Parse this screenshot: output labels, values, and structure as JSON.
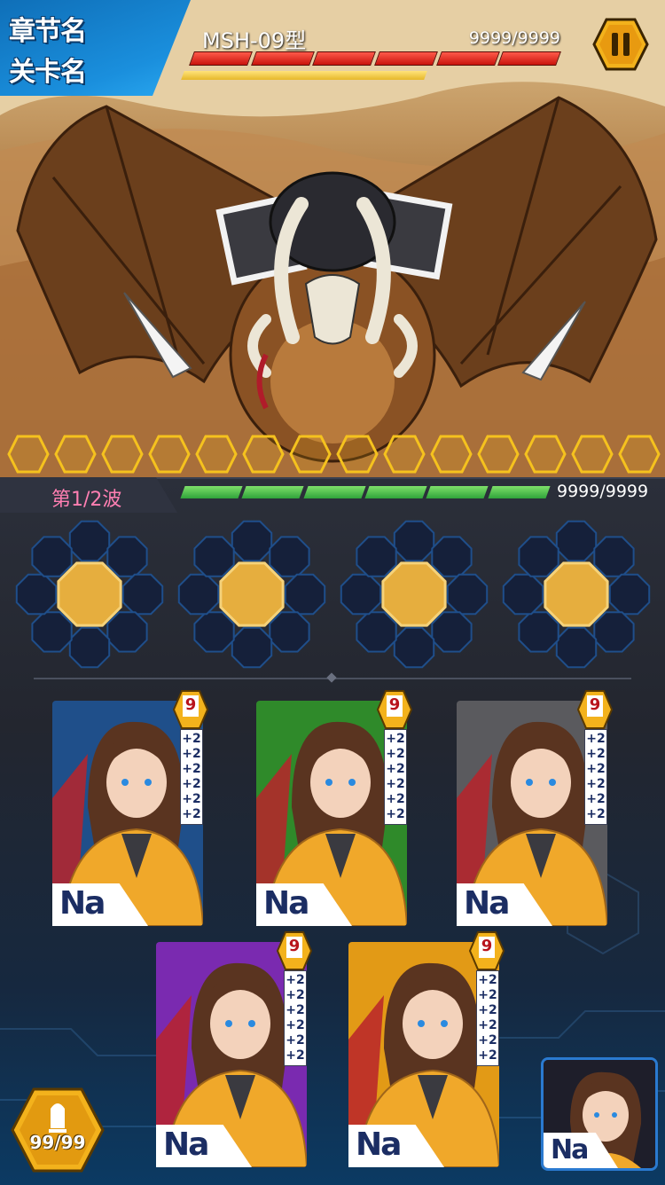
{
  "hud": {
    "chapter_name": "章节名",
    "stage_name": "关卡名",
    "boss_name": "MSH-09型",
    "boss_hp": "9999/9999",
    "boss_hp_segments": 6,
    "pause_icon": "pause-icon"
  },
  "energy": {
    "cells": 14,
    "filled": 0
  },
  "wave": {
    "label": "第1/2波",
    "hp": "9999/9999",
    "segments": 6
  },
  "slots": [
    {
      "name": "slot-1"
    },
    {
      "name": "slot-2"
    },
    {
      "name": "slot-3"
    },
    {
      "name": "slot-4"
    }
  ],
  "cards": [
    {
      "name": "Na",
      "level": "9",
      "bonuses": [
        "+2",
        "+2",
        "+2",
        "+2",
        "+2",
        "+2"
      ],
      "bg": "#1f4f8a"
    },
    {
      "name": "Na",
      "level": "9",
      "bonuses": [
        "+2",
        "+2",
        "+2",
        "+2",
        "+2",
        "+2"
      ],
      "bg": "#2f8a2a"
    },
    {
      "name": "Na",
      "level": "9",
      "bonuses": [
        "+2",
        "+2",
        "+2",
        "+2",
        "+2",
        "+2"
      ],
      "bg": "#5a5a5e"
    },
    {
      "name": "Na",
      "level": "9",
      "bonuses": [
        "+2",
        "+2",
        "+2",
        "+2",
        "+2",
        "+2"
      ],
      "bg": "#7a2ab0"
    },
    {
      "name": "Na",
      "level": "9",
      "bonuses": [
        "+2",
        "+2",
        "+2",
        "+2",
        "+2",
        "+2"
      ],
      "bg": "#e29a16"
    }
  ],
  "ammo": {
    "value": "99/99"
  },
  "reserve": {
    "name": "Na"
  },
  "colors": {
    "accent_blue": "#1a8fdd",
    "hp_red": "#e02a1c",
    "hp_green": "#3cb043",
    "gold": "#f0b020",
    "wave_pink": "#ff7fb2"
  }
}
